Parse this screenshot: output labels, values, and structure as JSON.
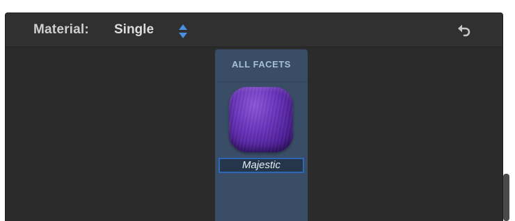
{
  "inspector": {
    "material_label": "Material:",
    "material_value": "Single",
    "stepper_icon": "up-down-arrows-icon",
    "reset_icon": "undo-arrow-icon"
  },
  "facets": {
    "title": "ALL FACETS",
    "material_name": "Majestic",
    "swatch_color": "#6a35bd"
  },
  "colors": {
    "panel_bg": "#2b2b2b",
    "column_bg": "#3a4d66",
    "accent": "#2f67b8",
    "stepper": "#4a90e2"
  }
}
